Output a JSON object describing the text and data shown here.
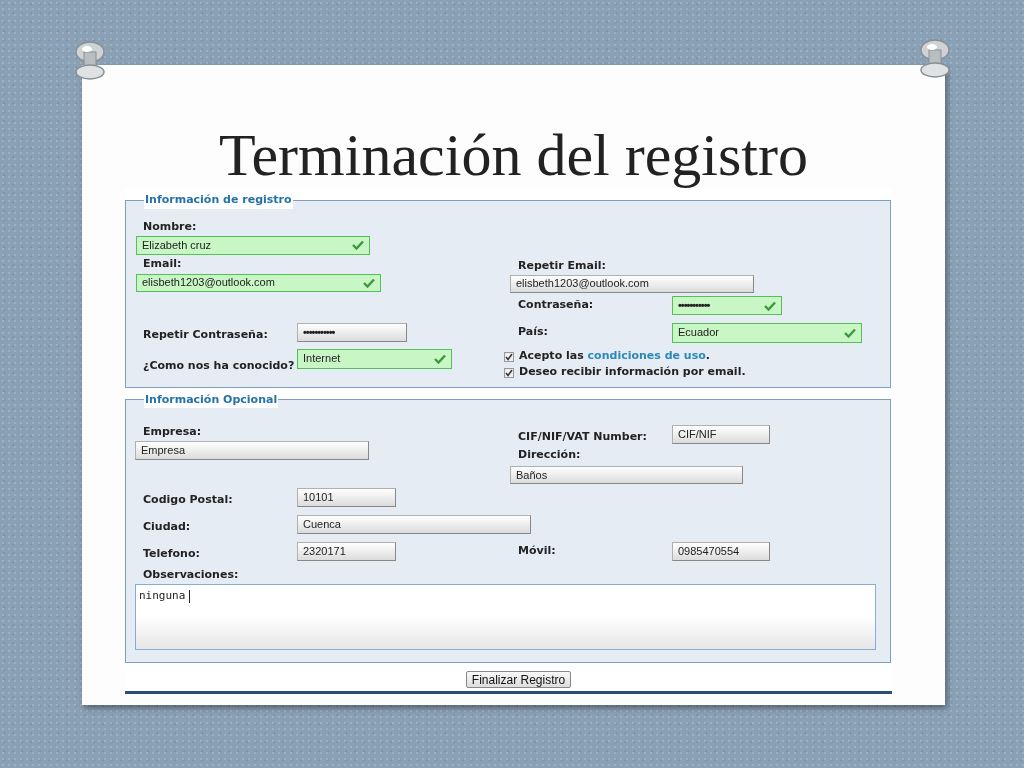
{
  "slide_title": "Terminación del registro",
  "registration": {
    "legend": "Información de registro",
    "fields": [
      {
        "label": "Nombre:",
        "value": "Elizabeth cruz",
        "valid": true,
        "kind": "text"
      },
      {
        "label": "Email:",
        "value": "elisbeth1203@outlook.com",
        "valid": true,
        "kind": "text"
      },
      {
        "label": "Repetir Email:",
        "value": "elisbeth1203@outlook.com",
        "valid": false,
        "kind": "text"
      },
      {
        "label": "Contraseña:",
        "value": "•••••••••••",
        "valid": true,
        "kind": "password"
      },
      {
        "label": "Repetir Contraseña:",
        "value": "•••••••••••",
        "valid": false,
        "kind": "password"
      },
      {
        "label": "País:",
        "value": "Ecuador",
        "valid": true,
        "kind": "select"
      },
      {
        "label": "¿Como nos ha conocido?",
        "value": "Internet",
        "valid": true,
        "kind": "select"
      }
    ],
    "checkboxes": [
      {
        "prefix": "Acepto las ",
        "link": "condiciones de uso",
        "suffix": ".",
        "checked": true
      },
      {
        "prefix": "Deseo recibir información por email.",
        "checked": true
      }
    ]
  },
  "optional": {
    "legend": "Información Opcional",
    "fields": [
      {
        "label": "Empresa:",
        "value": "Empresa",
        "valid": false,
        "kind": "text"
      },
      {
        "label": "CIF/NIF/VAT Number:",
        "value": "CIF/NIF",
        "valid": false,
        "kind": "text"
      },
      {
        "label": "Dirección:",
        "value": "Baños",
        "valid": false,
        "kind": "text"
      },
      {
        "label": "Codigo Postal:",
        "value": "10101",
        "valid": false,
        "kind": "text"
      },
      {
        "label": "Ciudad:",
        "value": "Cuenca",
        "valid": false,
        "kind": "text"
      },
      {
        "label": "Telefono:",
        "value": "2320171",
        "valid": false,
        "kind": "text"
      },
      {
        "label": "Móvil:",
        "value": "0985470554",
        "valid": false,
        "kind": "text"
      }
    ],
    "observations": {
      "label": "Observaciones:",
      "value": "ninguna"
    }
  },
  "submit_button": "Finalizar Registro"
}
